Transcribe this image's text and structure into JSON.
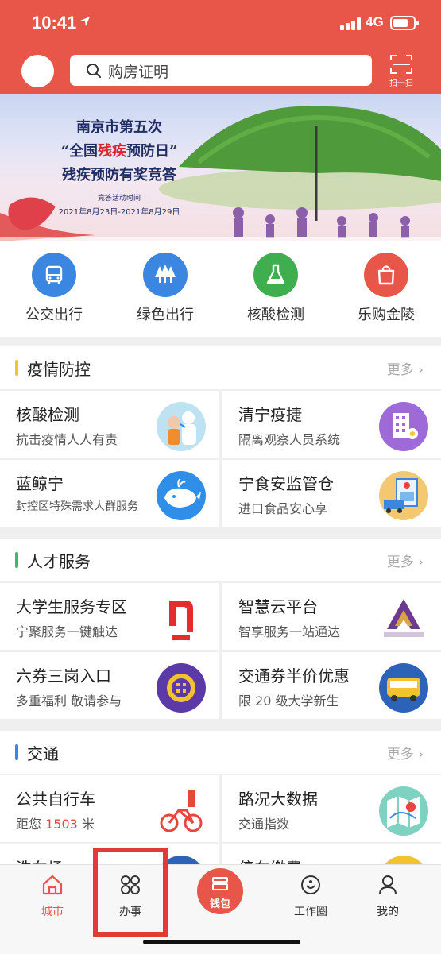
{
  "status_bar": {
    "time": "10:41",
    "network": "4G"
  },
  "search": {
    "placeholder": "购房证明"
  },
  "scan": {
    "label": "扫一扫"
  },
  "banner": {
    "line1": "南京市第五次",
    "line2_pre": "“全国",
    "line2_highlight": "残疾",
    "line2_post": "预防日”",
    "line3": "残疾预防有奖竞答",
    "line4": "竞答活动时间",
    "line5": "2021年8月23日-2021年8月29日"
  },
  "quick_services": [
    {
      "label": "公交出行",
      "color": "#3b86e0",
      "icon": "bus-icon"
    },
    {
      "label": "绿色出行",
      "color": "#3b86e0",
      "icon": "trees-icon"
    },
    {
      "label": "核酸检测",
      "color": "#3fae4e",
      "icon": "flask-icon"
    },
    {
      "label": "乐购金陵",
      "color": "#e8564a",
      "icon": "shopping-bag-icon"
    }
  ],
  "sections": [
    {
      "title": "疫情防控",
      "more": "更多",
      "bar_color": "#f2c230",
      "cards": [
        {
          "title": "核酸检测",
          "subtitle": "抗击疫情人人有责",
          "icon": "nurse-swab-icon"
        },
        {
          "title": "清宁疫捷",
          "subtitle": "隔离观察人员系统",
          "icon": "building-icon"
        },
        {
          "title": "蓝鲸宁",
          "subtitle": "封控区特殊需求人群服务",
          "icon": "whale-icon"
        },
        {
          "title": "宁食安监管仓",
          "subtitle": "进口食品安心享",
          "icon": "cold-storage-icon"
        }
      ]
    },
    {
      "title": "人才服务",
      "more": "更多",
      "bar_color": "#3fb86a",
      "cards": [
        {
          "title": "大学生服务专区",
          "subtitle": "宁聚服务一键触达",
          "icon": "ningju-logo-icon"
        },
        {
          "title": "智慧云平台",
          "subtitle": "智享服务一站通达",
          "icon": "zijinshan-logo-icon"
        },
        {
          "title": "六券三岗入口",
          "subtitle": "多重福利 敬请参与",
          "icon": "coupon-icon"
        },
        {
          "title": "交通券半价优惠",
          "subtitle": "限 20 级大学新生",
          "icon": "bus-icon"
        }
      ]
    },
    {
      "title": "交通",
      "more": "更多",
      "bar_color": "#3b86e0",
      "cards": [
        {
          "title": "公共自行车",
          "subtitle_pre": "距您",
          "subtitle_num": "1503",
          "subtitle_post": "米",
          "icon": "bicycle-icon"
        },
        {
          "title": "路况大数据",
          "subtitle": "交通指数",
          "icon": "map-icon"
        },
        {
          "title": "洗车场",
          "subtitle": "",
          "icon": "car-wash-icon"
        },
        {
          "title": "停车缴费",
          "subtitle": "",
          "icon": "parking-icon"
        }
      ]
    }
  ],
  "tabbar": {
    "city": "城市",
    "services": "办事",
    "wallet": "钱包",
    "circle": "工作圈",
    "mine": "我的"
  }
}
